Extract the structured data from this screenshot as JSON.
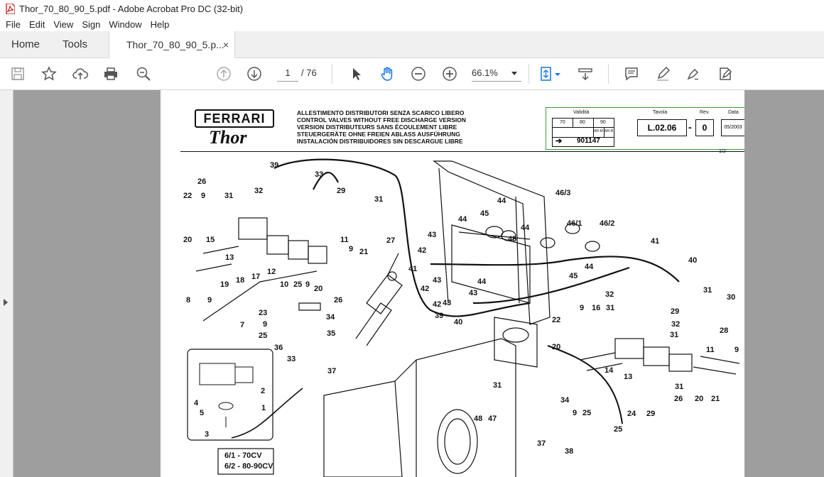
{
  "window": {
    "title": "Thor_70_80_90_5.pdf - Adobe Acrobat Pro DC (32-bit)"
  },
  "menu": {
    "items": [
      "File",
      "Edit",
      "View",
      "Sign",
      "Window",
      "Help"
    ]
  },
  "tabs": {
    "home": "Home",
    "tools": "Tools",
    "doc": "Thor_70_80_90_5.p...",
    "close": "×"
  },
  "toolbar": {
    "page_current": "1",
    "page_total": "/ 76",
    "zoom": "66.1%"
  },
  "document": {
    "logo": "FERRARI",
    "model": "Thor",
    "headlines": [
      "ALLESTIMENTO DISTRIBUTORI SENZA SCARICO LIBERO",
      "CONTROL VALVES WITHOUT FREE DISCHARGE VERSION",
      "VERSION DISTRIBUTEURS SANS ÉCOULEMENT LIBRE",
      "STEUERGERÄTE OHNE FREIEN ABLASS AUSFÜHRUNG",
      "INSTALACIÓN DISTRIBUIDORES SIN DESCARGUE LIBRE"
    ],
    "validita_label": "Validità",
    "models": [
      "70",
      "80",
      "90"
    ],
    "ar_m": "AR-M",
    "ar_r": "AR-R",
    "serial": "901147",
    "tavola_label": "Tavola",
    "tavola": "L.02.06",
    "rev_label": "Rev.",
    "rev": "0",
    "data_label": "Data",
    "date": "05/2003",
    "sheet": "1/2",
    "inset_caption_1": "6/1 - 70CV",
    "inset_caption_2": "6/2 - 80-90CV",
    "callouts": [
      "39",
      "33",
      "29",
      "31",
      "26",
      "22",
      "9",
      "32",
      "31",
      "20",
      "15",
      "13",
      "12",
      "17",
      "18",
      "19",
      "11",
      "9",
      "21",
      "27",
      "10",
      "25",
      "9",
      "20",
      "26",
      "8",
      "9",
      "7",
      "23",
      "9",
      "25",
      "36",
      "33",
      "37",
      "35",
      "34",
      "2",
      "4",
      "5",
      "1",
      "3",
      "44",
      "45",
      "44",
      "46/3",
      "46/1",
      "46/2",
      "43",
      "42",
      "41",
      "42",
      "43",
      "44",
      "43",
      "42",
      "39",
      "40",
      "45",
      "44",
      "41",
      "40",
      "32",
      "31",
      "30",
      "29",
      "32",
      "31",
      "28",
      "22",
      "9",
      "16",
      "31",
      "20",
      "14",
      "13",
      "31",
      "26",
      "20",
      "21",
      "11",
      "9",
      "34",
      "25",
      "9",
      "24",
      "29",
      "25",
      "38",
      "37",
      "48",
      "47",
      "31",
      "45",
      "44",
      "43"
    ]
  },
  "colors": {
    "viewer_bg": "#9e9e9e",
    "infobox_border": "#3a9a3a",
    "hand_tool": "#1473e6"
  }
}
